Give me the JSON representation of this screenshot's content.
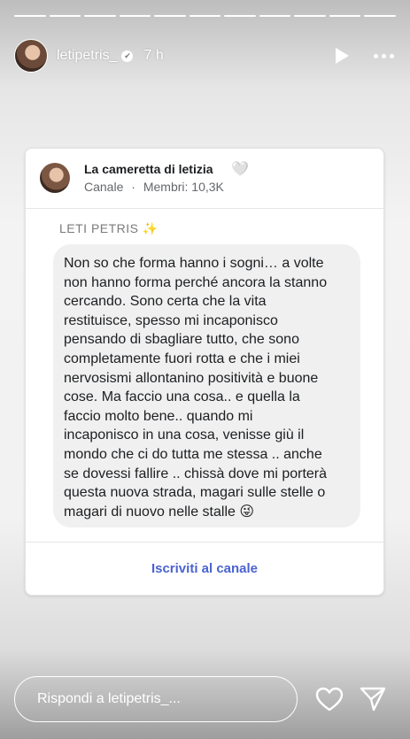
{
  "story": {
    "segments": 11,
    "username": "letipetris_",
    "verified_mark": "✔",
    "time_ago": "7 h"
  },
  "card": {
    "channel_title": "La cameretta di letizia",
    "channel_heart": "🤍",
    "channel_type": "Canale",
    "separator": "·",
    "members": "Membri: 10,3K",
    "sender": "LETI PETRIS",
    "sender_emoji": "✨",
    "message": "Non so che forma hanno i sogni… a volte\nnon hanno forma perché ancora la stanno\ncercando. Sono certa che la vita\nrestituisce, spesso mi incaponisco\npensando di sbagliare tutto, che sono\ncompletamente fuori rotta e che i miei\nnervosismi allontanino positività e buone\ncose. Ma faccio una cosa.. e quella la\nfaccio molto bene.. quando mi\nincaponisco in una cosa, venisse giù il\nmondo che ci do tutta me stessa .. anche\nse dovessi fallire .. chissà dove mi porterà\nquesta nuova strada, magari sulle stelle o\nmagari di nuovo nelle stalle 😜",
    "subscribe_label": "Iscriviti al canale"
  },
  "reply": {
    "placeholder": "Rispondi a letipetris_..."
  },
  "colors": {
    "accent": "#4a63d1",
    "bubble": "#f0f0f0"
  },
  "icons": [
    "play-icon",
    "more-icon",
    "heart-icon",
    "send-icon"
  ]
}
